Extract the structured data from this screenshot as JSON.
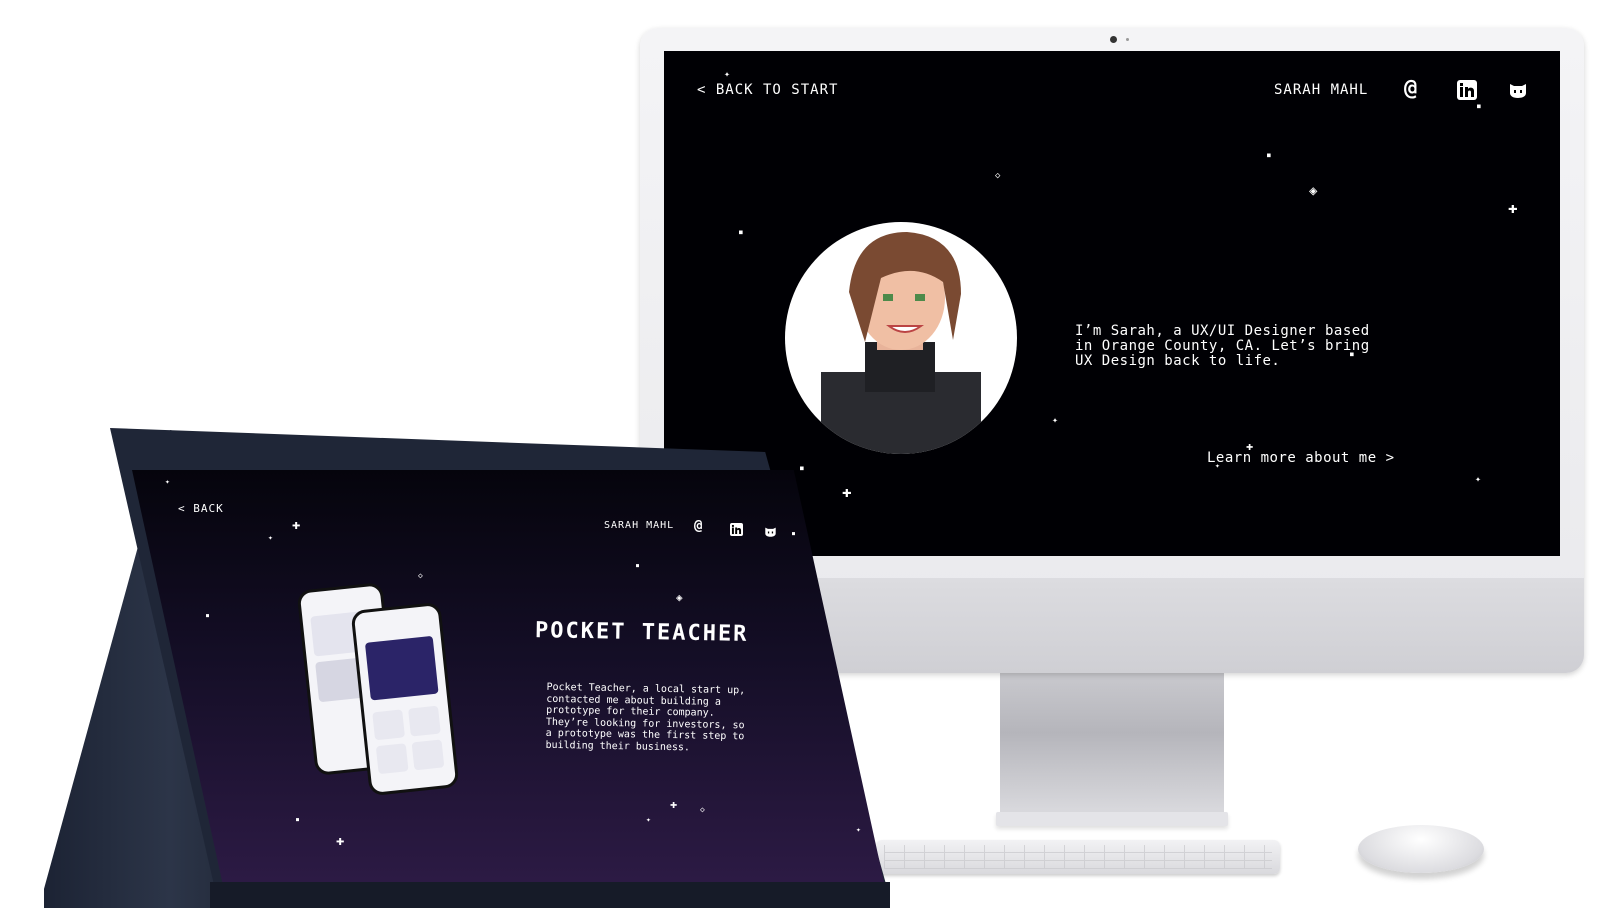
{
  "desktop": {
    "back_label": "BACK TO START",
    "name": "SARAH MAHL",
    "icons": [
      "at-icon",
      "linkedin-icon",
      "github-icon"
    ],
    "bio": "I’m Sarah, a UX/UI Designer based\nin Orange County, CA. Let’s bring\nUX Design back to life.",
    "learn_more": "Learn more about me"
  },
  "laptop": {
    "back_label": "BACK",
    "name": "SARAH MAHL",
    "icons": [
      "at-icon",
      "linkedin-icon",
      "github-icon"
    ],
    "project_title": "POCKET TEACHER",
    "project_description": "Pocket Teacher, a local start up,\ncontacted me about building a\nprototype for their company.\nThey’re looking for investors, so\na prototype was the first step to\nbuilding their business."
  },
  "colors": {
    "desktop_bg": "#000004",
    "laptop_bg_top": "#05040c",
    "laptop_bg_bottom": "#2c1a44",
    "text": "#ffffff"
  }
}
